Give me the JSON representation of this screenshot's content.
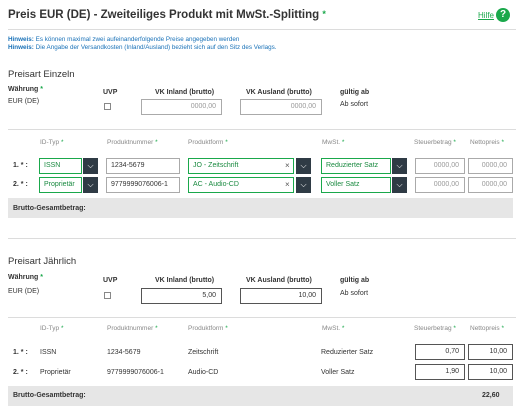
{
  "header": {
    "title": "Preis EUR (DE) - Zweiteiliges Produkt mit MwSt.-Splitting",
    "required_mark": "*",
    "help_label": "Hilfe",
    "help_icon": "?"
  },
  "hints": [
    {
      "label": "Hinweis:",
      "text": "Es können maximal zwei aufeinanderfolgende Preise angegeben werden"
    },
    {
      "label": "Hinweis:",
      "text": "Die Angabe der Versandkosten (Inland/Ausland) bezieht sich auf den Sitz des Verlags."
    }
  ],
  "labels": {
    "waehrung": "Währung",
    "uvp": "UVP",
    "vk_inland": "VK Inland (brutto)",
    "vk_ausland": "VK Ausland (brutto)",
    "gueltig_ab": "gültig ab",
    "required_mark": "*"
  },
  "columns": {
    "id_typ": "ID-Typ",
    "produktnummer": "Produktnummer",
    "produktform": "Produktform",
    "mwst": "MwSt.",
    "steuerbetrag": "Steuerbetrag",
    "nettopreis": "Nettopreis"
  },
  "einzeln": {
    "section_title": "Preisart Einzeln",
    "currency": "EUR (DE)",
    "uvp_checked": false,
    "vk_inland": "0000,00",
    "vk_ausland": "0000,00",
    "gueltig": "Ab sofort",
    "rows": [
      {
        "num": "1.",
        "id_typ": "ISSN",
        "produktnummer": "1234-5679",
        "produktform": "JO - Zeitschrift",
        "mwst": "Reduzierter Satz",
        "steuer": "0000,00",
        "netto": "0000,00"
      },
      {
        "num": "2.",
        "id_typ": "Proprietär",
        "produktnummer": "9779999076006-1",
        "produktform": "AC - Audio-CD",
        "mwst": "Voller Satz",
        "steuer": "0000,00",
        "netto": "0000,00"
      }
    ],
    "total_label": "Brutto-Gesamtbetrag:",
    "total_value": ""
  },
  "jaehrlich": {
    "section_title": "Preisart Jährlich",
    "currency": "EUR (DE)",
    "uvp_checked": false,
    "vk_inland": "5,00",
    "vk_ausland": "10,00",
    "gueltig": "Ab sofort",
    "rows": [
      {
        "num": "1.",
        "id_typ": "ISSN",
        "produktnummer": "1234-5679",
        "produktform": "Zeitschrift",
        "mwst": "Reduzierter Satz",
        "steuer": "0,70",
        "netto": "10,00"
      },
      {
        "num": "2.",
        "id_typ": "Proprietär",
        "produktnummer": "9779999076006-1",
        "produktform": "Audio-CD",
        "mwst": "Voller Satz",
        "steuer": "1,90",
        "netto": "10,00"
      }
    ],
    "total_label": "Brutto-Gesamtbetrag:",
    "total_value": "22,60"
  },
  "icons": {
    "chevron": "chevron-down-icon",
    "clear": "clear-icon",
    "help": "help-icon"
  },
  "colors": {
    "accent": "#1aa84b",
    "hint": "#1a72b8",
    "select_button": "#2f3b45",
    "total_bar": "#e6e6e6"
  }
}
